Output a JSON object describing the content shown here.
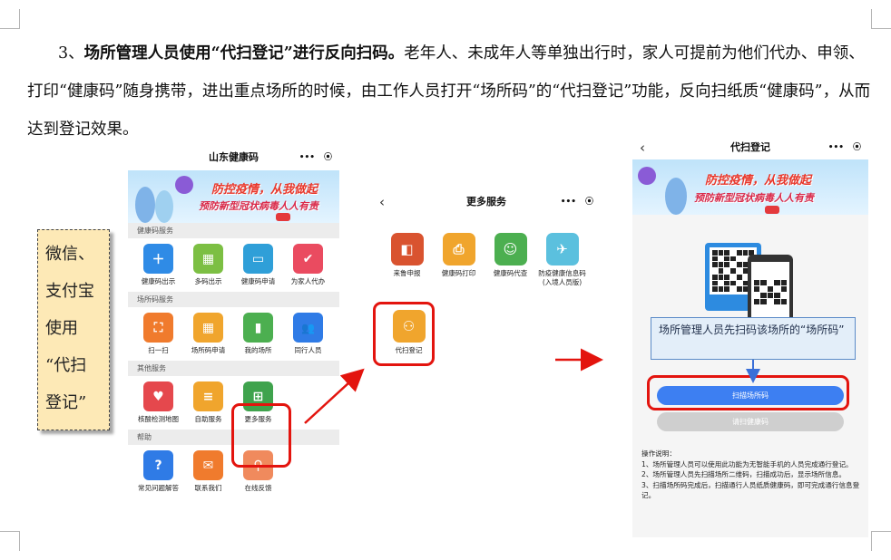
{
  "paragraph": {
    "number": "3、",
    "bold_title": "场所管理人员使用“代扫登记”进行反向扫码。",
    "body": "老年人、未成年人等单独出行时，家人可提前为他们代办、申领、打印“健康码”随身携带，进出重点场所的时候，由工作人员打开“场所码”的“代扫登记”功能，反向扫纸质“健康码”，从而达到登记效果。"
  },
  "side_note": {
    "lines": [
      "微信、",
      "支付宝",
      "使用",
      "“代扫",
      "登记”"
    ]
  },
  "phone1": {
    "title": "山东健康码",
    "capsule_more": "•••",
    "capsule_close": "⦿",
    "banner": {
      "text1": "防控疫情，从我做起",
      "text2": "预防新型冠状病毒人人有责"
    },
    "sections": [
      {
        "title": "健康码服务",
        "items": [
          {
            "label": "健康码出示",
            "icon": "health-code-show-icon",
            "color": "#2f8be6",
            "glyph": "＋"
          },
          {
            "label": "多码出示",
            "icon": "multi-code-icon",
            "color": "#7cbf43",
            "glyph": "▦"
          },
          {
            "label": "健康码申请",
            "icon": "code-apply-icon",
            "color": "#2f9fd8",
            "glyph": "▭"
          },
          {
            "label": "为家人代办",
            "icon": "family-proxy-icon",
            "color": "#ea4b60",
            "glyph": "✔"
          }
        ]
      },
      {
        "title": "场所码服务",
        "items": [
          {
            "label": "扫一扫",
            "icon": "scan-icon",
            "color": "#f07b2d",
            "glyph": "⛶"
          },
          {
            "label": "场所码申请",
            "icon": "venue-code-apply-icon",
            "color": "#f0a52d",
            "glyph": "▦"
          },
          {
            "label": "我的场所",
            "icon": "my-venue-icon",
            "color": "#4caf50",
            "glyph": "▮"
          },
          {
            "label": "同行人员",
            "icon": "companions-icon",
            "color": "#2f7be6",
            "glyph": "👥"
          }
        ]
      },
      {
        "title": "其他服务",
        "items": [
          {
            "label": "核酸检测地图",
            "icon": "dna-map-icon",
            "color": "#e5484d",
            "glyph": "♥"
          },
          {
            "label": "自助服务",
            "icon": "self-service-icon",
            "color": "#f0a52d",
            "glyph": "≡"
          },
          {
            "label": "更多服务",
            "icon": "more-services-icon",
            "color": "#3fa34d",
            "glyph": "⊞"
          }
        ]
      },
      {
        "title": "帮助",
        "items": [
          {
            "label": "常见问题解答",
            "icon": "faq-icon",
            "color": "#2f7be6",
            "glyph": "?"
          },
          {
            "label": "联系我们",
            "icon": "contact-icon",
            "color": "#f07b2d",
            "glyph": "✉"
          },
          {
            "label": "在线反馈",
            "icon": "feedback-icon",
            "color": "#f08a5d",
            "glyph": "⚲"
          }
        ]
      }
    ]
  },
  "phone2": {
    "title": "更多服务",
    "back": "‹",
    "capsule_more": "•••",
    "capsule_close": "⦿",
    "items": [
      {
        "label": "来鲁申报",
        "label2": "",
        "icon": "lu-declare-icon",
        "color": "#d9532f",
        "glyph": "◧"
      },
      {
        "label": "健康码打印",
        "label2": "",
        "icon": "print-icon",
        "color": "#f0a52d",
        "glyph": "⎙"
      },
      {
        "label": "健康码代查",
        "label2": "",
        "icon": "proxy-check-icon",
        "color": "#4caf50",
        "glyph": "☺"
      },
      {
        "label": "防疫健康信息码",
        "label2": "(入境人员版)",
        "icon": "entry-info-icon",
        "color": "#5bc0de",
        "glyph": "✈"
      }
    ],
    "highlighted": {
      "label": "代扫登记",
      "icon": "proxy-scan-register-icon",
      "color": "#f0a52d",
      "glyph": "⚇"
    }
  },
  "phone3": {
    "title": "代扫登记",
    "back": "‹",
    "capsule_more": "•••",
    "capsule_close": "⦿",
    "banner": {
      "text1": "防控疫情，从我做起",
      "text2": "预防新型冠状病毒人人有责"
    },
    "scan_venue_button": "扫描场所码",
    "scan_health_button": "请扫健康码",
    "instructions": [
      "操作说明：",
      "1、场所管理人员可以使用此功能为无智能手机的人员完成通行登记。",
      "2、场所管理人员先扫描场所二维码，扫描成功后，显示场所信息。",
      "3、扫描场所码完成后，扫描通行人员纸质健康码，即可完成通行信息登记。"
    ]
  },
  "callout": {
    "text": "场所管理人员先扫码该场所的“场所码”"
  },
  "colors": {
    "highlight_red": "#e3140e",
    "button_blue": "#3d7ff2"
  }
}
